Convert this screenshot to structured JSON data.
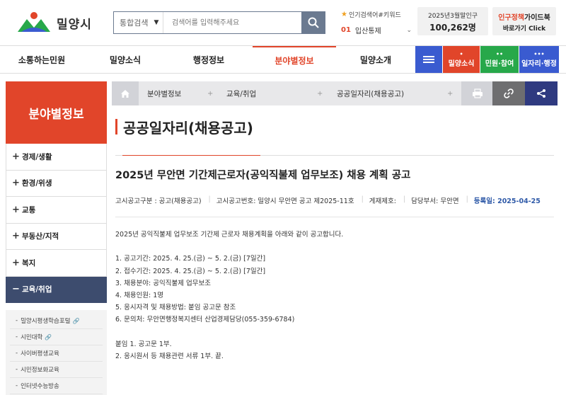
{
  "header": {
    "logo_text": "밀양시",
    "search_select": "통합검색",
    "search_placeholder": "검색어를 입력해주세요",
    "popular_title": "인기검색어#키워드",
    "popular_rank": "01",
    "popular_keyword": "입산통제",
    "population_label": "2025년3월말인구",
    "population_value": "100,262명",
    "guide_red": "인구정책",
    "guide_black": "가이드북",
    "guide_sub": "바로가기 Click"
  },
  "nav": {
    "items": [
      "소통하는민원",
      "밀양소식",
      "행정정보",
      "분야별정보",
      "밀양소개"
    ],
    "active_index": 3,
    "quick": [
      {
        "label": "밀양소식",
        "dots": "•",
        "color": "#e1452a"
      },
      {
        "label": "민원·참여",
        "dots": "••",
        "color": "#27a84a"
      },
      {
        "label": "일자리·행정",
        "dots": "•••",
        "color": "#3a5bd0"
      }
    ]
  },
  "sidebar": {
    "title": "분야별정보",
    "items": [
      {
        "label": "경제/생활",
        "pm": "+"
      },
      {
        "label": "환경/위생",
        "pm": "+"
      },
      {
        "label": "교통",
        "pm": "+"
      },
      {
        "label": "부동산/지적",
        "pm": "+"
      },
      {
        "label": "복지",
        "pm": "+"
      },
      {
        "label": "교육/취업",
        "pm": "−"
      }
    ],
    "sub_items": [
      {
        "label": "밀양시평생학습포털",
        "external": true
      },
      {
        "label": "시민대학",
        "external": true
      },
      {
        "label": "사이버평생교육",
        "external": false
      },
      {
        "label": "시민정보화교육",
        "external": false
      },
      {
        "label": "인터넷수능방송",
        "external": false
      }
    ]
  },
  "breadcrumb": {
    "items": [
      "분야별정보",
      "교육/취업",
      "공공일자리(채용공고)"
    ]
  },
  "content": {
    "page_title": "공공일자리(채용공고)",
    "post_title": "2025년 무안면 기간제근로자(공익직불제 업무보조) 채용 계획 공고",
    "meta": {
      "notice_type": "고시공고구분 : 공고(채용공고)",
      "notice_no": "고시공고번호: 밀양시 무안면 공고 제2025-11호",
      "posting_no": "게재제호:",
      "department": "담당부서: 무안면",
      "registered": "등록일: 2025-04-25"
    },
    "body": [
      "2025년 공익직불제 업무보조 기간제 근로자 채용계획을 아래와 같이 공고합니다.",
      "",
      "1. 공고기간: 2025. 4. 25.(금) ~ 5. 2.(금) [7일간]",
      "2. 접수기간: 2025. 4. 25.(금) ~ 5. 2.(금) [7일간]",
      "3. 채용분야: 공익직불제 업무보조",
      "4. 채용인원: 1명",
      "5. 응시자격 및 채용방법: 붙임 공고문 참조",
      "6. 문의처: 무안면행정복지센터 산업경제담당(055-359-6784)",
      "",
      "붙임 1. 공고문 1부.",
      "2. 응시원서 등 채용관련 서류 1부. 끝."
    ]
  },
  "colors": {
    "accent_red": "#e1452a",
    "navy": "#3d4c6e",
    "blue": "#3a5bd0",
    "green": "#27a84a"
  }
}
